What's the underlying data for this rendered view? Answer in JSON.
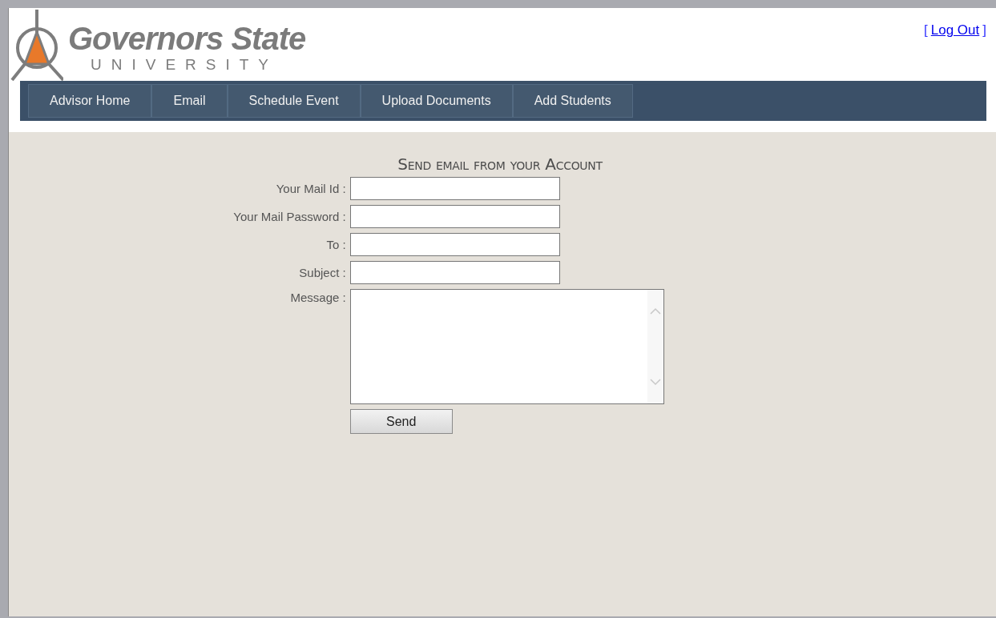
{
  "logo": {
    "name": "Governors State",
    "sub": "UNIVERSITY"
  },
  "logout": {
    "open": "[",
    "label": "Log Out",
    "close": "]"
  },
  "nav": [
    {
      "label": "Advisor Home"
    },
    {
      "label": "Email"
    },
    {
      "label": "Schedule Event"
    },
    {
      "label": "Upload Documents"
    },
    {
      "label": "Add Students"
    }
  ],
  "form": {
    "title": "Send email from your Account",
    "fields": [
      {
        "kind": "text",
        "label": "Your Mail Id :"
      },
      {
        "kind": "password",
        "label": "Your Mail Password :"
      },
      {
        "kind": "text",
        "label": "To :"
      },
      {
        "kind": "text",
        "label": "Subject :"
      },
      {
        "kind": "textarea",
        "label": "Message :"
      }
    ],
    "button": "Send"
  }
}
